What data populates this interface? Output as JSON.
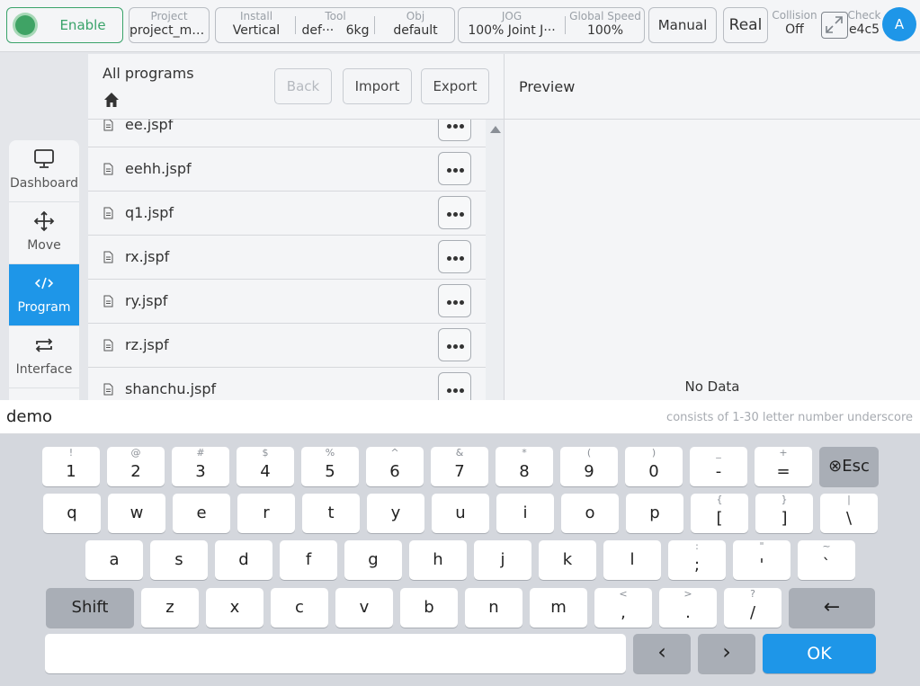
{
  "topbar": {
    "enable_label": "Enable",
    "project": {
      "label": "Project",
      "value": "project_mo···"
    },
    "install": {
      "label": "Install",
      "value": "Vertical"
    },
    "tool": {
      "label": "Tool",
      "value_name": "def···",
      "value_weight": "6kg"
    },
    "obj": {
      "label": "Obj",
      "value": "default"
    },
    "jog": {
      "label": "JOG",
      "value": "100%  Joint J···"
    },
    "global_speed": {
      "label": "Global Speed",
      "value": "100%"
    },
    "manual_label": "Manual",
    "real_label": "Real",
    "collision": {
      "label": "Collision",
      "value": "Off"
    },
    "check": {
      "label": "Check",
      "value": "e4c5"
    },
    "avatar_letter": "A"
  },
  "nav": {
    "items": [
      {
        "label": "Dashboard",
        "icon": "monitor-icon"
      },
      {
        "label": "Move",
        "icon": "move-arrows-icon"
      },
      {
        "label": "Program",
        "icon": "code-icon"
      },
      {
        "label": "Interface",
        "icon": "swap-icon"
      }
    ],
    "active": "Program"
  },
  "list": {
    "title": "All programs",
    "back_label": "Back",
    "import_label": "Import",
    "export_label": "Export",
    "files": [
      "ee.jspf",
      "eehh.jspf",
      "q1.jspf",
      "rx.jspf",
      "ry.jspf",
      "rz.jspf",
      "shanchu.jspf"
    ]
  },
  "preview": {
    "title": "Preview",
    "empty_text": "No Data"
  },
  "input": {
    "value": "demo",
    "hint": "consists of 1-30 letter number underscore"
  },
  "keyboard": {
    "row1": [
      {
        "sub": "!",
        "main": "1"
      },
      {
        "sub": "@",
        "main": "2"
      },
      {
        "sub": "#",
        "main": "3"
      },
      {
        "sub": "$",
        "main": "4"
      },
      {
        "sub": "%",
        "main": "5"
      },
      {
        "sub": "^",
        "main": "6"
      },
      {
        "sub": "&",
        "main": "7"
      },
      {
        "sub": "*",
        "main": "8"
      },
      {
        "sub": "(",
        "main": "9"
      },
      {
        "sub": ")",
        "main": "0"
      },
      {
        "sub": "_",
        "main": "-"
      },
      {
        "sub": "+",
        "main": "="
      }
    ],
    "esc_label": "⊗Esc",
    "row2": [
      {
        "sub": "",
        "main": "q"
      },
      {
        "sub": "",
        "main": "w"
      },
      {
        "sub": "",
        "main": "e"
      },
      {
        "sub": "",
        "main": "r"
      },
      {
        "sub": "",
        "main": "t"
      },
      {
        "sub": "",
        "main": "y"
      },
      {
        "sub": "",
        "main": "u"
      },
      {
        "sub": "",
        "main": "i"
      },
      {
        "sub": "",
        "main": "o"
      },
      {
        "sub": "",
        "main": "p"
      },
      {
        "sub": "{",
        "main": "["
      },
      {
        "sub": "}",
        "main": "]"
      },
      {
        "sub": "|",
        "main": "\\"
      }
    ],
    "row3": [
      {
        "sub": "",
        "main": "a"
      },
      {
        "sub": "",
        "main": "s"
      },
      {
        "sub": "",
        "main": "d"
      },
      {
        "sub": "",
        "main": "f"
      },
      {
        "sub": "",
        "main": "g"
      },
      {
        "sub": "",
        "main": "h"
      },
      {
        "sub": "",
        "main": "j"
      },
      {
        "sub": "",
        "main": "k"
      },
      {
        "sub": "",
        "main": "l"
      },
      {
        "sub": ":",
        "main": ";"
      },
      {
        "sub": "\"",
        "main": "'"
      },
      {
        "sub": "~",
        "main": "`"
      }
    ],
    "shift_label": "Shift",
    "row4": [
      {
        "sub": "",
        "main": "z"
      },
      {
        "sub": "",
        "main": "x"
      },
      {
        "sub": "",
        "main": "c"
      },
      {
        "sub": "",
        "main": "v"
      },
      {
        "sub": "",
        "main": "b"
      },
      {
        "sub": "",
        "main": "n"
      },
      {
        "sub": "",
        "main": "m"
      },
      {
        "sub": "<",
        "main": ","
      },
      {
        "sub": ">",
        "main": "."
      },
      {
        "sub": "?",
        "main": "/"
      }
    ],
    "backspace_label": "←",
    "left_label": "‹",
    "right_label": "›",
    "ok_label": "OK"
  },
  "colors": {
    "accent": "#1e96e8",
    "enable_green": "#3aa36a",
    "key_gray": "#a9aeb6"
  }
}
